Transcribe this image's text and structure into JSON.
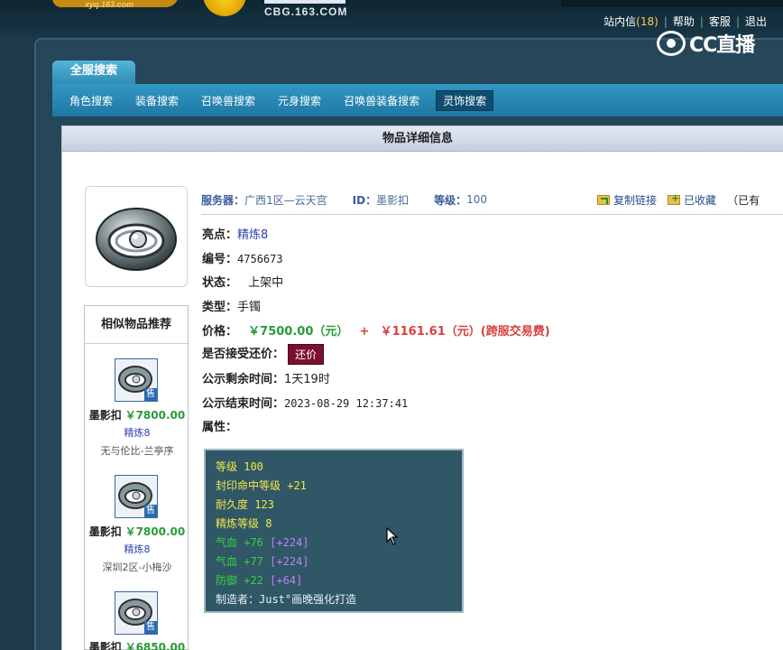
{
  "header": {
    "logo1_url": "xyq.163.com",
    "logo2_url": "CBG.163.COM",
    "links": {
      "messages_label": "站内信",
      "messages_count": "(18)",
      "help": "帮助",
      "service": "客服",
      "logout": "退出"
    },
    "watermark": "CC直播"
  },
  "nav": {
    "main_tab": "全服搜索",
    "sub_items": [
      "角色搜索",
      "装备搜索",
      "召唤兽搜索",
      "元身搜索",
      "召唤兽装备搜索",
      "灵饰搜索"
    ],
    "active_index": 5
  },
  "panel": {
    "title": "物品详细信息"
  },
  "item": {
    "server_label": "服务器：",
    "server_value": "广西1区—云天宫",
    "id_label": "ID：",
    "id_value": "墨影扣",
    "level_label": "等级：",
    "level_value": "100",
    "copy_link": "复制链接",
    "favorited": "已收藏",
    "extra_cut": "（已有",
    "highlight_label": "亮点：",
    "highlight_value": "精炼8",
    "number_label": "编号：",
    "number_value": "4756673",
    "status_label": "状态：",
    "status_value": "上架中",
    "type_label": "类型：",
    "type_value": "手镯",
    "price_label": "价格：",
    "price_value": "￥7500.00（元）",
    "price_plus": "+",
    "fee_value": "￥1161.61（元）(跨服交易费)",
    "haggle_label": "是否接受还价：",
    "haggle_button": "还价",
    "remaining_label": "公示剩余时间：",
    "remaining_value": "1天19时",
    "end_label": "公示结束时间：",
    "end_value": "2023-08-29 12:37:41",
    "attr_label": "属性："
  },
  "attributes": [
    {
      "text": "等级 100",
      "color": "y"
    },
    {
      "text": "封印命中等级 +21",
      "color": "y"
    },
    {
      "text": "耐久度 123",
      "color": "y"
    },
    {
      "text": "精炼等级 8",
      "color": "y"
    },
    {
      "text": "气血 +76",
      "extra": "[+224]",
      "color": "g"
    },
    {
      "text": "气血 +77",
      "extra": "[+224]",
      "color": "g"
    },
    {
      "text": "防御 +22",
      "extra": "[+64]",
      "color": "g"
    },
    {
      "text": "制造者：Just°画晚强化打造",
      "color": "w"
    }
  ],
  "similar": {
    "title": "相似物品推荐",
    "tag": "售",
    "items": [
      {
        "name": "墨影扣",
        "price": "￥7800.00",
        "refine": "精炼8",
        "server": "无与伦比-兰亭序"
      },
      {
        "name": "墨影扣",
        "price": "￥7800.00",
        "refine": "精炼8",
        "server": "深圳2区-小梅沙"
      },
      {
        "name": "墨影扣",
        "price": "￥6850.00",
        "refine": "",
        "server": ""
      }
    ]
  }
}
